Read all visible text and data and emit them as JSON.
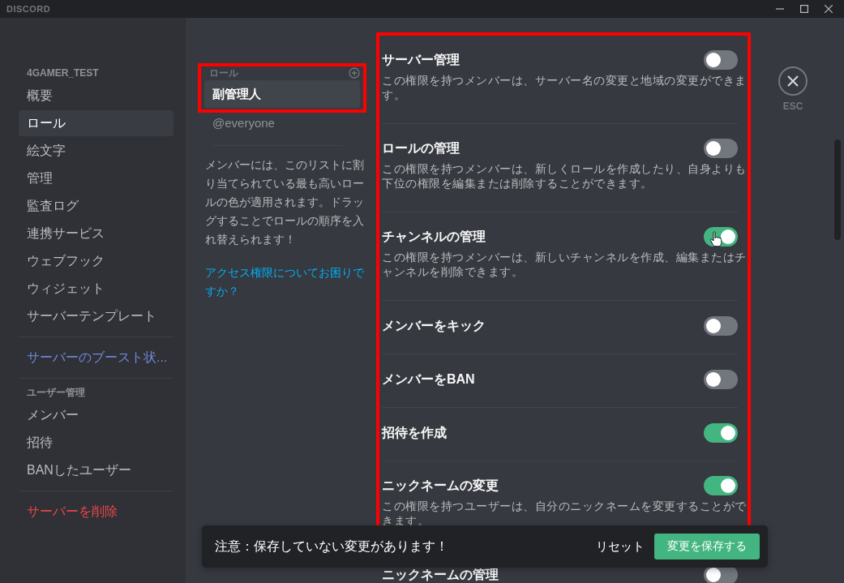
{
  "titlebar": {
    "logo": "DISCORD"
  },
  "sidebar": {
    "sections": [
      {
        "header": "4GAMER_TEST",
        "items": [
          {
            "label": "概要",
            "kind": "normal",
            "selected": false
          },
          {
            "label": "ロール",
            "kind": "normal",
            "selected": true
          },
          {
            "label": "絵文字",
            "kind": "normal",
            "selected": false
          },
          {
            "label": "管理",
            "kind": "normal",
            "selected": false
          },
          {
            "label": "監査ログ",
            "kind": "normal",
            "selected": false
          },
          {
            "label": "連携サービス",
            "kind": "normal",
            "selected": false
          },
          {
            "label": "ウェブフック",
            "kind": "normal",
            "selected": false
          },
          {
            "label": "ウィジェット",
            "kind": "normal",
            "selected": false
          },
          {
            "label": "サーバーテンプレート",
            "kind": "normal",
            "selected": false
          }
        ]
      },
      {
        "items": [
          {
            "label": "サーバーのブースト状...",
            "kind": "boost",
            "selected": false
          }
        ]
      },
      {
        "header": "ユーザー管理",
        "items": [
          {
            "label": "メンバー",
            "kind": "normal",
            "selected": false
          },
          {
            "label": "招待",
            "kind": "normal",
            "selected": false
          },
          {
            "label": "BANしたユーザー",
            "kind": "normal",
            "selected": false
          }
        ]
      },
      {
        "items": [
          {
            "label": "サーバーを削除",
            "kind": "danger",
            "selected": false
          }
        ]
      }
    ]
  },
  "roles_panel": {
    "header": "ロール",
    "highlighted": true,
    "roles": [
      {
        "name": "副管理人",
        "selected": true
      },
      {
        "name": "@everyone",
        "selected": false
      }
    ],
    "help": "メンバーには、このリストに割り当てられている最も高いロールの色が適用されます。ドラッグすることでロールの順序を入れ替えられます！",
    "link": "アクセス権限についてお困りですか？"
  },
  "permissions": [
    {
      "title": "サーバー管理",
      "description": "この権限を持つメンバーは、サーバー名の変更と地域の変更ができます。",
      "on": false,
      "highlighted": true
    },
    {
      "title": "ロールの管理",
      "description": "この権限を持つメンバーは、新しくロールを作成したり、自身よりも下位の権限を編集または削除することができます。",
      "on": false,
      "highlighted": true
    },
    {
      "title": "チャンネルの管理",
      "description": "この権限を持つメンバーは、新しいチャンネルを作成、編集またはチャンネルを削除できます。",
      "on": true,
      "highlighted": true
    },
    {
      "title": "メンバーをキック",
      "on": false,
      "highlighted": true
    },
    {
      "title": "メンバーをBAN",
      "on": false,
      "highlighted": true
    },
    {
      "title": "招待を作成",
      "on": true,
      "highlighted": true
    },
    {
      "title": "ニックネームの変更",
      "description": "この権限を持つユーザーは、自分のニックネームを変更することができます。",
      "on": true,
      "highlighted": true
    },
    {
      "title": "ニックネームの管理",
      "on": false,
      "highlighted": false
    }
  ],
  "close": {
    "label": "ESC"
  },
  "save_bar": {
    "message": "注意：保存していない変更があります！",
    "reset": "リセット",
    "save": "変更を保存する"
  }
}
